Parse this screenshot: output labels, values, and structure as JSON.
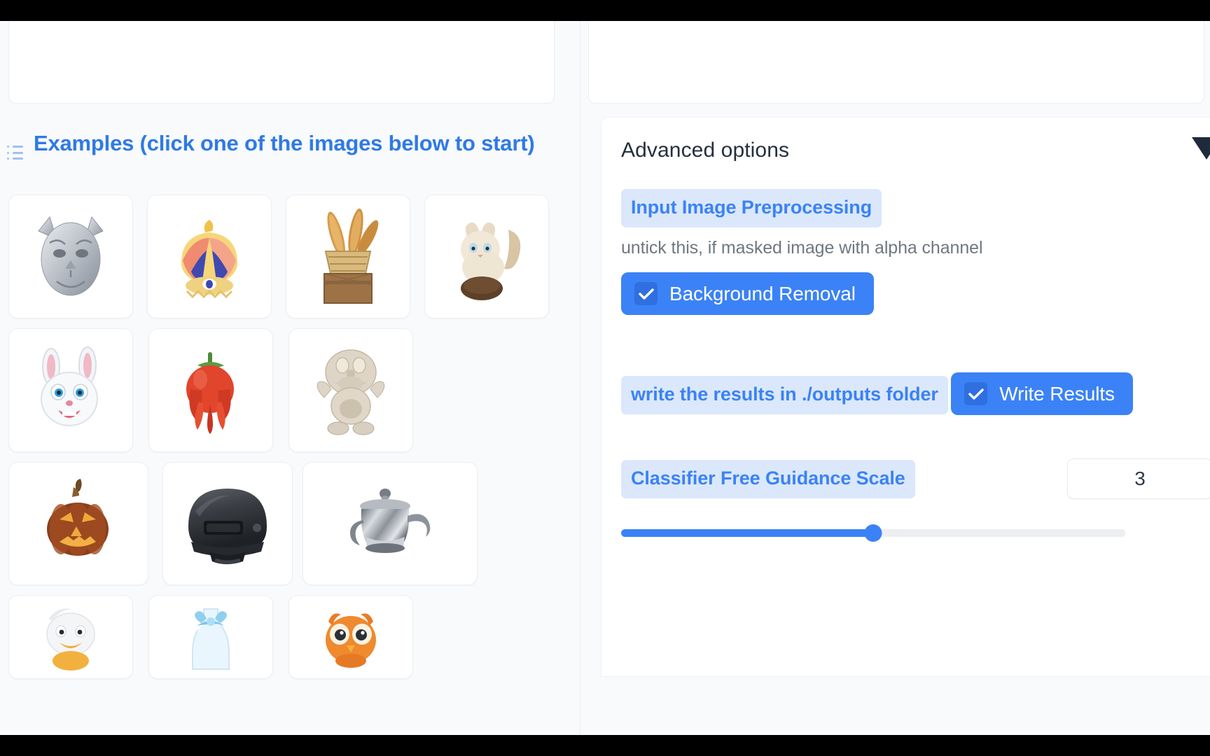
{
  "window": {
    "background": "#f8fafc",
    "accent": "#3b82f6",
    "chip_bg": "#dbe8fb"
  },
  "left_panel": {
    "preview_card": {
      "name": "input-preview-card"
    },
    "examples": {
      "icon": "list-icon",
      "title": "Examples (click one of the images below to start)",
      "rows": [
        {
          "items": [
            {
              "name": "example-tiger-head",
              "label": "tiger head sculpture"
            },
            {
              "name": "example-crown",
              "label": "ornate crown"
            },
            {
              "name": "example-bread-basket",
              "label": "bread basket on crate"
            },
            {
              "name": "example-cat",
              "label": "cream colored cat"
            }
          ]
        },
        {
          "items": [
            {
              "name": "example-rabbit",
              "label": "white rabbit face"
            },
            {
              "name": "example-pepper",
              "label": "red bell pepper"
            },
            {
              "name": "example-doraemon",
              "label": "stone cartoon figure"
            }
          ]
        },
        {
          "items": [
            {
              "name": "example-pumpkin",
              "label": "carved jack-o-lantern"
            },
            {
              "name": "example-helmet",
              "label": "tactical combat helmet"
            },
            {
              "name": "example-teapot",
              "label": "metal teapot"
            }
          ]
        },
        {
          "items": [
            {
              "name": "example-duck",
              "label": "duck figure"
            },
            {
              "name": "example-bottle",
              "label": "blue bow bottle"
            },
            {
              "name": "example-owl",
              "label": "orange owl"
            }
          ]
        }
      ]
    }
  },
  "right_panel": {
    "header": {
      "title": "Advanced options",
      "collapse_icon": "chevron-down-icon"
    },
    "options": [
      {
        "id": "input-image-preprocessing",
        "chip": "Input Image Preprocessing",
        "helper": "untick this, if masked image with alpha channel",
        "checkbox": {
          "name": "background-removal-checkbox",
          "label": "Background Removal",
          "checked": true
        }
      },
      {
        "id": "write-results",
        "chip": "write the results in ./outputs folder",
        "helper": "",
        "checkbox": {
          "name": "write-results-checkbox",
          "label": "Write Results",
          "checked": true
        }
      }
    ],
    "slider": {
      "id": "classifier-free-guidance-scale",
      "chip": "Classifier Free Guidance Scale",
      "value": "3",
      "percent": 50
    }
  }
}
